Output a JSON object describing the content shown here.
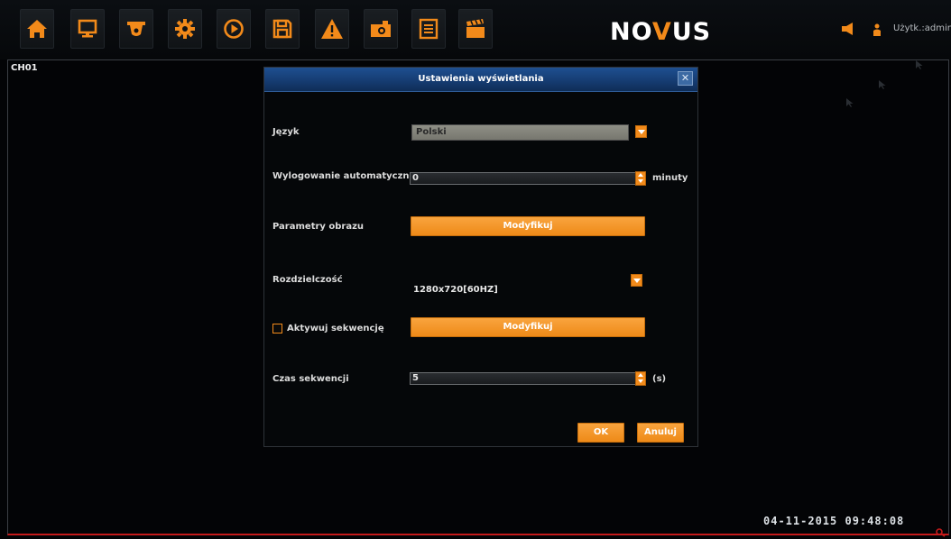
{
  "toolbar": {
    "buttons": [
      {
        "name": "home-icon"
      },
      {
        "name": "display-icon"
      },
      {
        "name": "camera-icon"
      },
      {
        "name": "settings-icon"
      },
      {
        "name": "playback-icon"
      },
      {
        "name": "backup-icon"
      },
      {
        "name": "alarm-icon"
      },
      {
        "name": "snapshot-icon"
      },
      {
        "name": "log-icon"
      },
      {
        "name": "clapperboard-icon"
      }
    ],
    "logo_prefix": "NO",
    "logo_v": "V",
    "logo_suffix": "US",
    "user_label": "Użytk.:admin"
  },
  "live": {
    "channel": "CH01",
    "datetime": "04-11-2015 09:48:08"
  },
  "dialog": {
    "title": "Ustawienia wyświetlania",
    "close_symbol": "✕",
    "language": {
      "label": "Język",
      "value": "Polski"
    },
    "auto_logout": {
      "label": "Wylogowanie automatyczne",
      "value": "0",
      "unit": "minuty"
    },
    "image_params": {
      "label": "Parametry obrazu",
      "button": "Modyfikuj"
    },
    "resolution": {
      "label": "Rozdzielczość",
      "value": "1280x720[60HZ]"
    },
    "sequence": {
      "label": "Aktywuj sekwencję",
      "button": "Modyfikuj",
      "checked": false
    },
    "sequence_time": {
      "label": "Czas sekwencji",
      "value": "5",
      "unit": "(s)"
    },
    "ok_label": "OK",
    "cancel_label": "Anuluj"
  },
  "colors": {
    "accent": "#f28a1a",
    "header": "#1e4f90",
    "background": "#030406",
    "status_line": "#c41a1a"
  }
}
